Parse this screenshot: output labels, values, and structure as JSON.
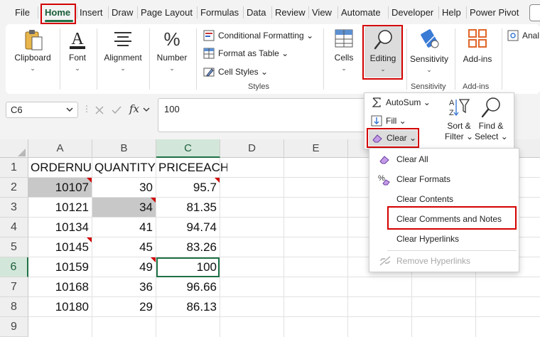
{
  "menu_tabs": [
    "File",
    "Home",
    "Insert",
    "Draw",
    "Page Layout",
    "Formulas",
    "Data",
    "Review",
    "View",
    "Automate",
    "Developer",
    "Help",
    "Power Pivot"
  ],
  "ribbon": {
    "clipboard_label": "Clipboard",
    "font_label": "Font",
    "alignment_label": "Alignment",
    "number_label": "Number",
    "conditional_formatting": "Conditional Formatting",
    "format_as_table": "Format as Table",
    "cell_styles": "Cell Styles",
    "styles_group": "Styles",
    "cells_label": "Cells",
    "editing_label": "Editing",
    "sensitivity_label": "Sensitivity",
    "sensitivity_group": "Sensitivity",
    "addins_label": "Add-ins",
    "addins_group": "Add-ins",
    "analyze_label": "Anal"
  },
  "formula_bar": {
    "name_box": "C6",
    "fx": "fx",
    "value": "100"
  },
  "editing_panel": {
    "autosum": "AutoSum",
    "fill": "Fill",
    "clear": "Clear",
    "sort_filter_1": "Sort &",
    "sort_filter_2": "Filter",
    "find_select_1": "Find &",
    "find_select_2": "Select"
  },
  "clear_menu": {
    "items": [
      "Clear All",
      "Clear Formats",
      "Clear Contents",
      "Clear Comments and Notes",
      "Clear Hyperlinks",
      "Remove Hyperlinks"
    ]
  },
  "sheet": {
    "columns": [
      "A",
      "B",
      "C",
      "D",
      "E"
    ],
    "rows": [
      "1",
      "2",
      "3",
      "4",
      "5",
      "6",
      "7",
      "8",
      "9"
    ],
    "headers": [
      "ORDERNU",
      "QUANTITY",
      "PRICEEACH"
    ],
    "data": [
      [
        "10107",
        "30",
        "95.7"
      ],
      [
        "10121",
        "34",
        "81.35"
      ],
      [
        "10134",
        "41",
        "94.74"
      ],
      [
        "10145",
        "45",
        "83.26"
      ],
      [
        "10159",
        "49",
        "100"
      ],
      [
        "10168",
        "36",
        "96.66"
      ],
      [
        "10180",
        "29",
        "86.13"
      ]
    ]
  },
  "colors": {
    "accent": "#1e7145",
    "highlight": "#d40000",
    "comment_marker": "#d00000"
  }
}
